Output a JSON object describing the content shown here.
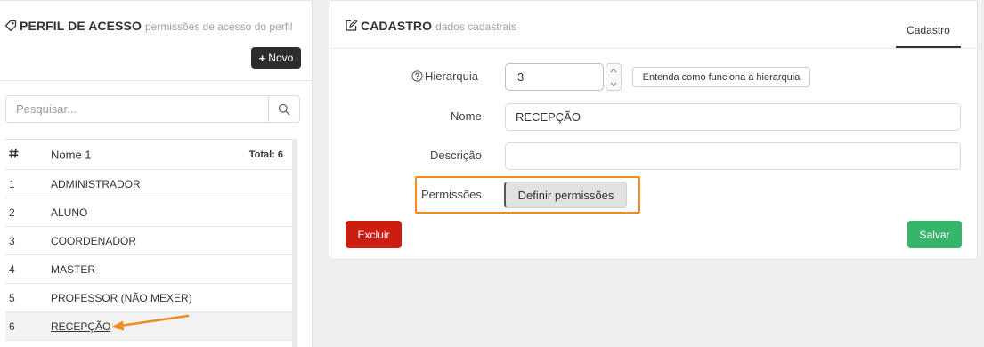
{
  "profile_list": {
    "title": "PERFIL DE ACESSO",
    "subtitle": "permissões de acesso do perfil",
    "new_button_label": "Novo",
    "search": {
      "placeholder": "Pesquisar...",
      "value": ""
    },
    "table": {
      "id_header_icon": "hash-icon",
      "name_header": "Nome 1",
      "total_label": "Total: 6",
      "rows": [
        {
          "id": "1",
          "name": "ADMINISTRADOR"
        },
        {
          "id": "2",
          "name": "ALUNO"
        },
        {
          "id": "3",
          "name": "COORDENADOR"
        },
        {
          "id": "4",
          "name": "MASTER"
        },
        {
          "id": "5",
          "name": "PROFESSOR (NÃO MEXER)"
        },
        {
          "id": "6",
          "name": "RECEPÇÃO"
        }
      ],
      "selected_row": "6"
    }
  },
  "cadastro": {
    "title": "CADASTRO",
    "subtitle": "dados cadastrais",
    "tab_label": "Cadastro",
    "hierarchy": {
      "label": "Hierarquia",
      "value": "3",
      "help_button_label": "Entenda como funciona a hierarquia"
    },
    "name": {
      "label": "Nome",
      "value": "RECEPÇÃO"
    },
    "description": {
      "label": "Descrição",
      "value": ""
    },
    "permissions": {
      "label": "Permissões",
      "button_label": "Definir permissões"
    },
    "delete_button_label": "Excluir",
    "save_button_label": "Salvar"
  },
  "colors": {
    "page_background": "#efefef",
    "dark_button": "#2b2e2a",
    "danger": "#cc1d13",
    "success": "#36b56b",
    "annotation": "#f28b1e"
  }
}
